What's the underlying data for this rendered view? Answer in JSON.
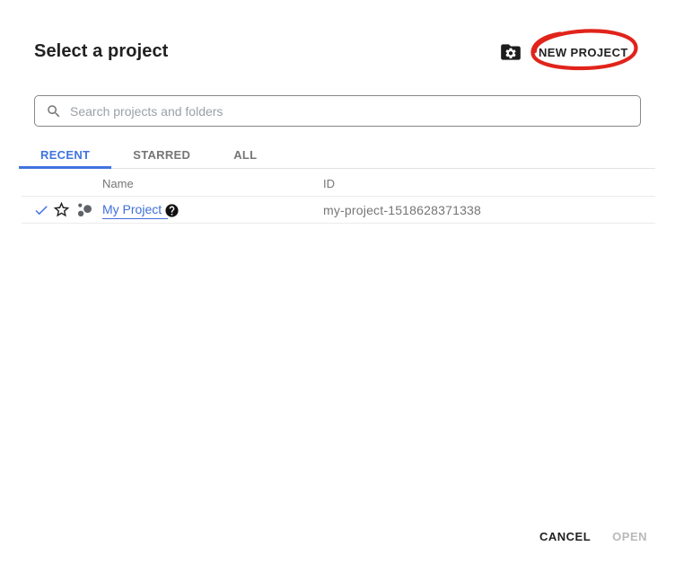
{
  "dialog": {
    "title": "Select a project",
    "new_project_label": "NEW PROJECT"
  },
  "search": {
    "placeholder": "Search projects and folders",
    "value": ""
  },
  "tabs": [
    {
      "label": "RECENT",
      "active": true
    },
    {
      "label": "STARRED",
      "active": false
    },
    {
      "label": "ALL",
      "active": false
    }
  ],
  "table": {
    "columns": [
      "Name",
      "ID"
    ],
    "rows": [
      {
        "name": "My Project",
        "id": "my-project-1518628371338",
        "selected": true,
        "starred": false
      }
    ]
  },
  "footer": {
    "cancel_label": "CANCEL",
    "open_label": "OPEN",
    "open_disabled": true
  },
  "icons": {
    "new_project": "black folder with white gear",
    "search": "magnifier",
    "selected": "blue checkmark",
    "star": "star outline (not starred)",
    "project": "three-dots project glyph",
    "help": "black circle with white question mark"
  },
  "annotation": {
    "shape": "hand-drawn red ellipse around NEW PROJECT",
    "color": "#e0241b"
  },
  "colors": {
    "accent_blue": "#4173df",
    "link_blue": "#3f6fd9",
    "text_dark": "#212121",
    "text_gray": "#757575",
    "divider": "#e3e3e3",
    "disabled": "#b9b9b9"
  }
}
